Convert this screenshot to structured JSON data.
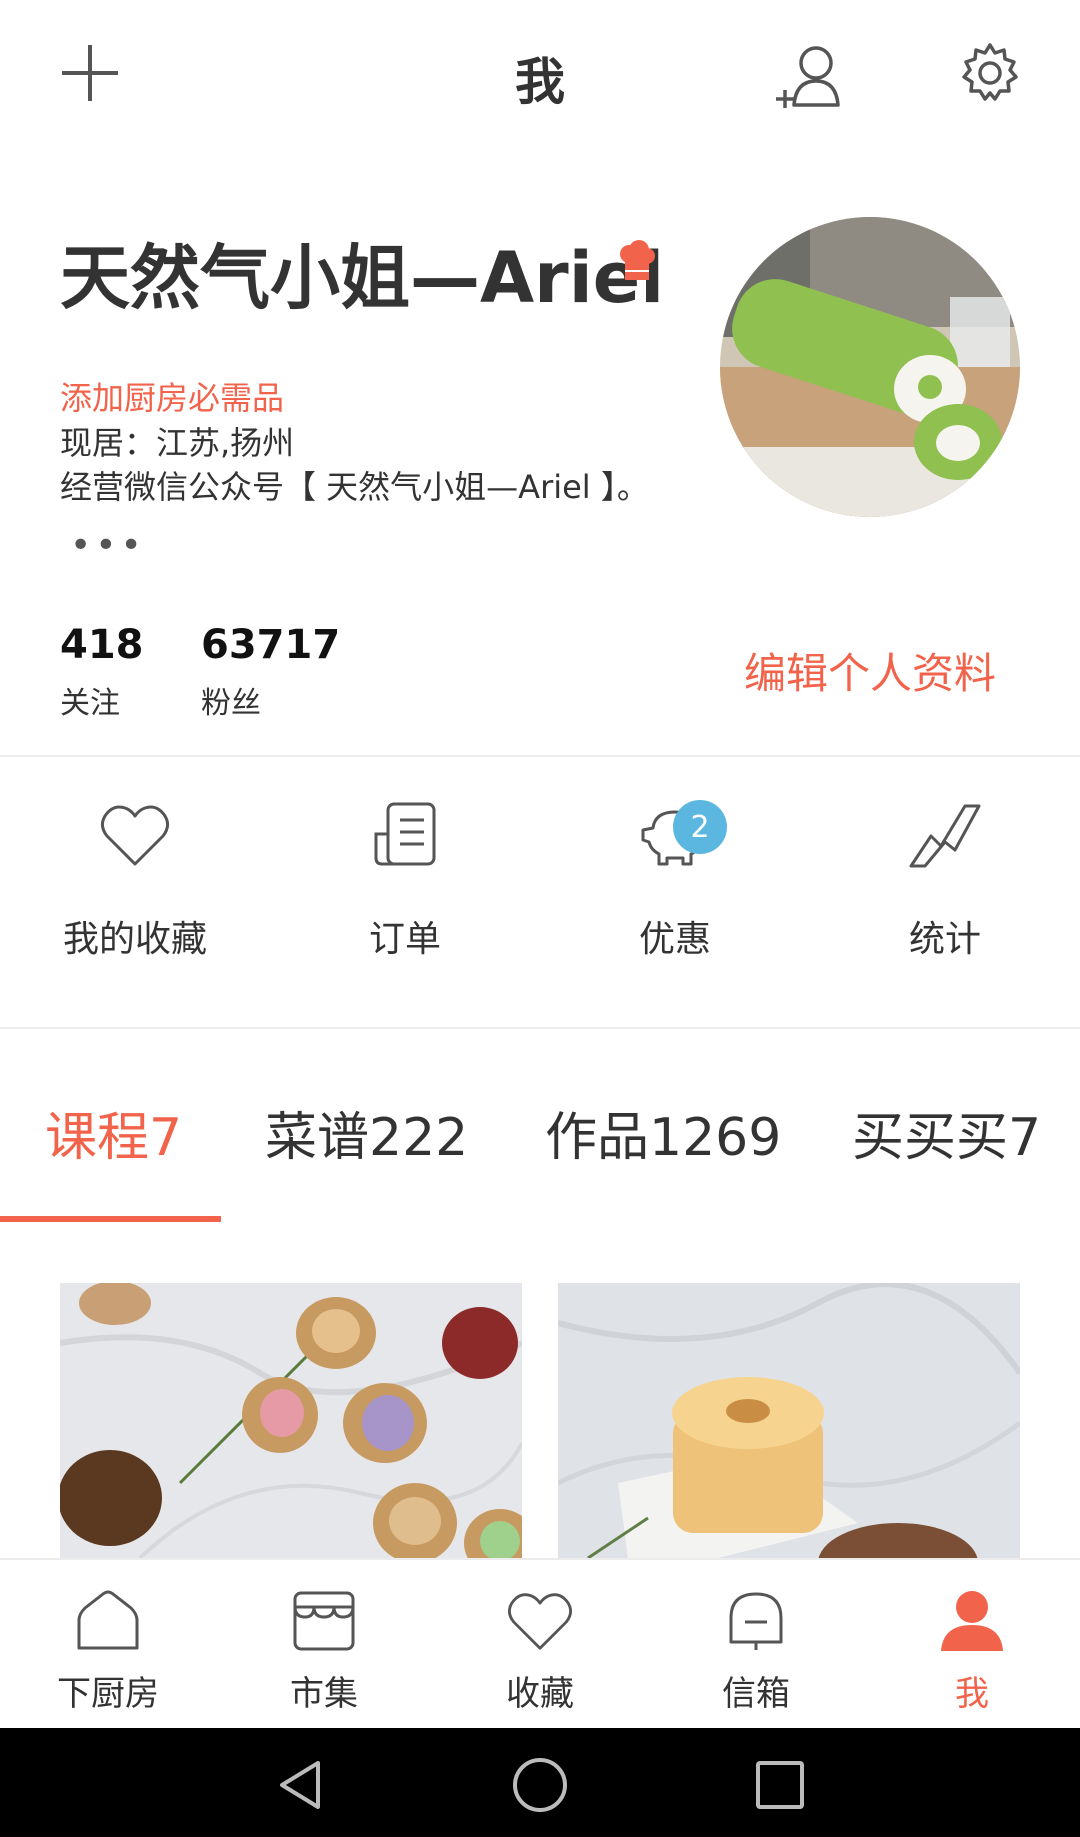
{
  "header": {
    "title": "我"
  },
  "profile": {
    "name": "天然气小姐—Ariel",
    "bio_link": "添加厨房必需品",
    "location": "现居：江苏,扬州",
    "description": "经营微信公众号【 天然气小姐—Ariel 】。",
    "more": "•••"
  },
  "stats": {
    "following_count": "418",
    "following_label": "关注",
    "fans_count": "63717",
    "fans_label": "粉丝",
    "edit_label": "编辑个人资料"
  },
  "quick_menu": [
    {
      "label": "我的收藏",
      "icon": "heart-icon"
    },
    {
      "label": "订单",
      "icon": "receipt-icon"
    },
    {
      "label": "优惠",
      "icon": "piggy-bank-icon",
      "badge": "2"
    },
    {
      "label": "统计",
      "icon": "trend-icon"
    }
  ],
  "tabs": [
    {
      "label": "课程7",
      "active": true
    },
    {
      "label": "菜谱222",
      "active": false
    },
    {
      "label": "作品1269",
      "active": false
    },
    {
      "label": "买买买7",
      "active": false
    }
  ],
  "bottom_nav": [
    {
      "label": "下厨房",
      "icon": "house-icon"
    },
    {
      "label": "市集",
      "icon": "store-icon"
    },
    {
      "label": "收藏",
      "icon": "heart-icon"
    },
    {
      "label": "信箱",
      "icon": "bell-icon"
    },
    {
      "label": "我",
      "icon": "person-icon",
      "active": true
    }
  ],
  "colors": {
    "accent": "#f2634b",
    "badge": "#5bb7e0",
    "text": "#333333"
  }
}
